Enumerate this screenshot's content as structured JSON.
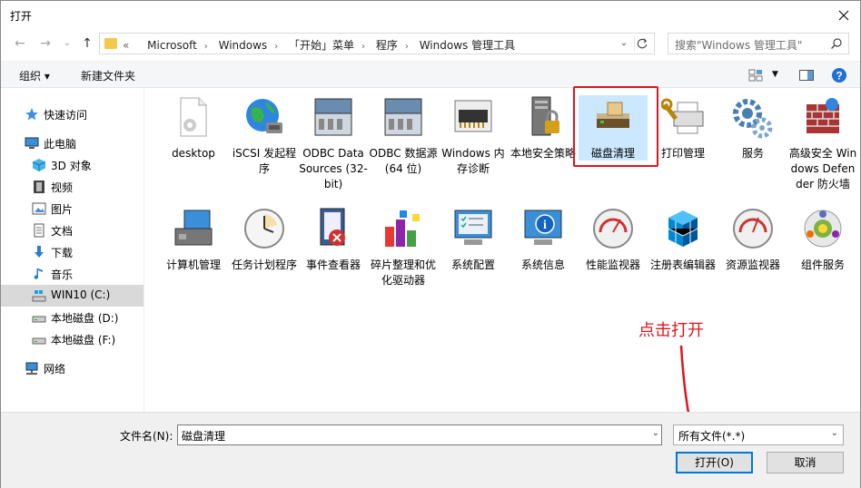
{
  "window": {
    "title": "打开"
  },
  "nav": {
    "crumbs": [
      "«",
      "Microsoft",
      "Windows",
      "「开始」菜单",
      "程序",
      "Windows 管理工具"
    ],
    "search_placeholder": "搜索\"Windows 管理工具\""
  },
  "toolbar": {
    "organize": "组织 ▾",
    "new_folder": "新建文件夹"
  },
  "sidebar": {
    "items": [
      {
        "label": "快速访问",
        "icon": "star-icon"
      },
      {
        "label": "此电脑",
        "icon": "computer-icon"
      },
      {
        "label": "3D 对象",
        "icon": "cube-icon"
      },
      {
        "label": "视频",
        "icon": "video-icon"
      },
      {
        "label": "图片",
        "icon": "picture-icon"
      },
      {
        "label": "文档",
        "icon": "document-icon"
      },
      {
        "label": "下载",
        "icon": "download-icon"
      },
      {
        "label": "音乐",
        "icon": "music-icon"
      },
      {
        "label": "WIN10 (C:)",
        "icon": "drive-icon"
      },
      {
        "label": "本地磁盘 (D:)",
        "icon": "drive-icon"
      },
      {
        "label": "本地磁盘 (F:)",
        "icon": "drive-icon"
      },
      {
        "label": "网络",
        "icon": "network-icon"
      }
    ]
  },
  "files": [
    {
      "label": "desktop",
      "icon": "ini-file-icon"
    },
    {
      "label": "iSCSI 发起程序",
      "icon": "globe-icon"
    },
    {
      "label": "ODBC Data Sources (32-bit)",
      "icon": "toolbox-icon"
    },
    {
      "label": "ODBC 数据源(64 位)",
      "icon": "toolbox-icon"
    },
    {
      "label": "Windows 内存诊断",
      "icon": "memory-chip-icon"
    },
    {
      "label": "本地安全策略",
      "icon": "security-policy-icon"
    },
    {
      "label": "磁盘清理",
      "icon": "disk-cleanup-icon"
    },
    {
      "label": "打印管理",
      "icon": "printer-icon"
    },
    {
      "label": "服务",
      "icon": "gears-icon"
    },
    {
      "label": "高级安全 Windows Defender 防火墙",
      "icon": "firewall-icon"
    },
    {
      "label": "计算机管理",
      "icon": "computer-management-icon"
    },
    {
      "label": "任务计划程序",
      "icon": "clock-icon"
    },
    {
      "label": "事件查看器",
      "icon": "event-viewer-icon"
    },
    {
      "label": "碎片整理和优化驱动器",
      "icon": "defrag-icon"
    },
    {
      "label": "系统配置",
      "icon": "system-config-icon"
    },
    {
      "label": "系统信息",
      "icon": "system-info-icon"
    },
    {
      "label": "性能监视器",
      "icon": "gauge-icon"
    },
    {
      "label": "注册表编辑器",
      "icon": "registry-icon"
    },
    {
      "label": "资源监视器",
      "icon": "gauge-icon"
    },
    {
      "label": "组件服务",
      "icon": "component-services-icon"
    }
  ],
  "annotation": "点击打开",
  "bottom": {
    "filename_label": "文件名(N):",
    "filename_value": "磁盘清理",
    "filetype_value": "所有文件(*.*)",
    "open_label": "打开(O)",
    "cancel_label": "取消"
  },
  "colors": {
    "annotation_red": "#e0141e",
    "accent": "#0078d7",
    "selection": "#cce8ff"
  }
}
